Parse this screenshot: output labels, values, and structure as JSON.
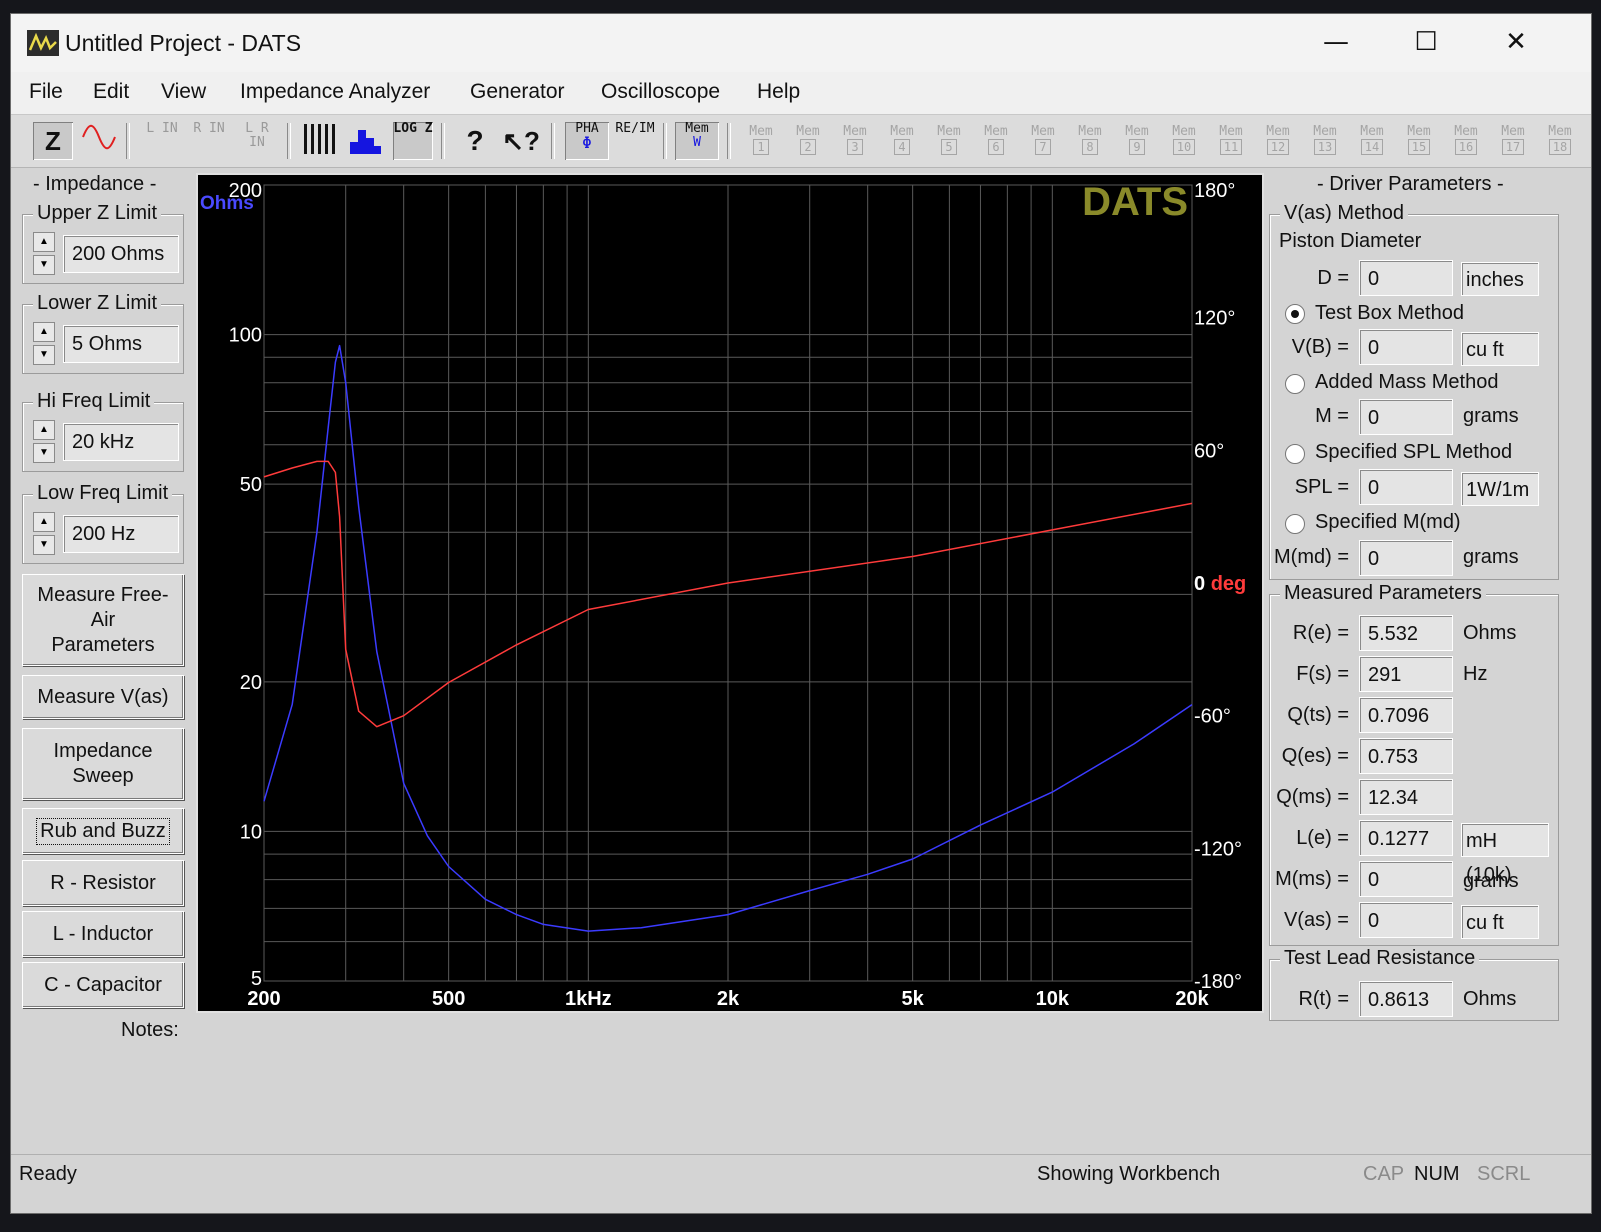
{
  "window": {
    "title": "Untitled Project - DATS",
    "minimize": "—",
    "maximize": "☐",
    "close": "✕"
  },
  "menu": [
    "File",
    "Edit",
    "View",
    "Impedance Analyzer",
    "Generator",
    "Oscilloscope",
    "Help"
  ],
  "toolbar": {
    "z": "Z",
    "l_in": "L IN",
    "r_in": "R IN",
    "lr_in": "L R IN",
    "log_z": "LOG Z",
    "pha": "PHA",
    "pha_sym": "Φ",
    "re_im": "RE/IM",
    "mem_w": "Mem",
    "mem_w_sym": "W",
    "mem_label": "Mem",
    "mem_slots": [
      "1",
      "2",
      "3",
      "4",
      "5",
      "6",
      "7",
      "8",
      "9",
      "10",
      "11",
      "12",
      "13",
      "14",
      "15",
      "16",
      "17",
      "18"
    ]
  },
  "left": {
    "impedance_header": "- Impedance -",
    "upper_z_label": "Upper Z Limit",
    "upper_z_value": "200 Ohms",
    "lower_z_label": "Lower Z Limit",
    "lower_z_value": "5 Ohms",
    "hi_freq_label": "Hi Freq Limit",
    "hi_freq_value": "20 kHz",
    "low_freq_label": "Low Freq Limit",
    "low_freq_value": "200 Hz",
    "btn_free_air": "Measure Free-Air Parameters",
    "btn_vas": "Measure V(as)",
    "btn_sweep": "Impedance Sweep",
    "btn_rub": "Rub and Buzz",
    "btn_resistor": "R - Resistor",
    "btn_inductor": "L - Inductor",
    "btn_capacitor": "C - Capacitor",
    "notes": "Notes:"
  },
  "right": {
    "header": "- Driver Parameters -",
    "vas_method": "V(as) Method",
    "piston_diameter": "Piston Diameter",
    "d_label": "D =",
    "d_value": "0",
    "d_unit": "inches",
    "test_box": "Test Box Method",
    "vb_label": "V(B) =",
    "vb_value": "0",
    "vb_unit": "cu ft",
    "added_mass": "Added Mass Method",
    "m_label": "M =",
    "m_value": "0",
    "m_unit": "grams",
    "spl_method": "Specified SPL Method",
    "spl_label": "SPL =",
    "spl_value": "0",
    "spl_unit": "1W/1m",
    "mmd_method": "Specified M(md)",
    "mmd_label": "M(md) =",
    "mmd_value": "0",
    "mmd_unit": "grams",
    "measured": "Measured Parameters",
    "re_label": "R(e) =",
    "re_value": "5.532",
    "re_unit": "Ohms",
    "fs_label": "F(s) =",
    "fs_value": "291",
    "fs_unit": "Hz",
    "qts_label": "Q(ts) =",
    "qts_value": "0.7096",
    "qes_label": "Q(es) =",
    "qes_value": "0.753",
    "qms_label": "Q(ms) =",
    "qms_value": "12.34",
    "le_label": "L(e) =",
    "le_value": "0.1277",
    "le_unit": "mH (10k)",
    "mms_label": "M(ms) =",
    "mms_value": "0",
    "mms_unit": "grams",
    "vas_label": "V(as) =",
    "vas_value": "0",
    "vas_unit": "cu ft",
    "test_lead": "Test Lead Resistance",
    "rt_label": "R(t) =",
    "rt_value": "0.8613",
    "rt_unit": "Ohms"
  },
  "status": {
    "ready": "Ready",
    "center": "Showing Workbench",
    "cap": "CAP",
    "num": "NUM",
    "scrl": "SCRL"
  },
  "chart_data": {
    "type": "line",
    "watermark": "DATS",
    "xscale": "log",
    "xlim": [
      200,
      20000
    ],
    "ylim_left": [
      5,
      200
    ],
    "yscale_left": "log",
    "ylim_right": [
      -180,
      180
    ],
    "left_unit": "Ohms",
    "right_unit": "deg",
    "x_ticks": [
      {
        "v": 200,
        "label": "200"
      },
      {
        "v": 500,
        "label": "500"
      },
      {
        "v": 1000,
        "label": "1kHz"
      },
      {
        "v": 2000,
        "label": "2k"
      },
      {
        "v": 5000,
        "label": "5k"
      },
      {
        "v": 10000,
        "label": "10k"
      },
      {
        "v": 20000,
        "label": "20k"
      }
    ],
    "y_ticks_left": [
      {
        "v": 200,
        "label": "200"
      },
      {
        "v": 100,
        "label": "100"
      },
      {
        "v": 50,
        "label": "50"
      },
      {
        "v": 20,
        "label": "20"
      },
      {
        "v": 10,
        "label": "10"
      },
      {
        "v": 5,
        "label": "5"
      }
    ],
    "y_ticks_right": [
      {
        "v": 180,
        "label": "180°"
      },
      {
        "v": 120,
        "label": "120°"
      },
      {
        "v": 60,
        "label": "60°"
      },
      {
        "v": 0,
        "label": "0 deg"
      },
      {
        "v": -60,
        "label": "-60°"
      },
      {
        "v": -120,
        "label": "-120°"
      },
      {
        "v": -180,
        "label": "-180°"
      }
    ],
    "grid": true,
    "series": [
      {
        "color": "#3b3bff",
        "axis": "left",
        "x": [
          200,
          230,
          260,
          275,
          285,
          291,
          300,
          320,
          350,
          400,
          450,
          500,
          600,
          700,
          800,
          1000,
          1300,
          2000,
          3000,
          4000,
          5000,
          7000,
          10000,
          15000,
          20000
        ],
        "y": [
          11.5,
          18,
          40,
          65,
          88,
          95,
          80,
          45,
          23,
          12.5,
          9.8,
          8.5,
          7.3,
          6.8,
          6.5,
          6.3,
          6.4,
          6.8,
          7.6,
          8.2,
          8.8,
          10.3,
          12,
          15,
          18
        ]
      },
      {
        "color": "#ff3b3b",
        "axis": "right",
        "x": [
          200,
          230,
          260,
          275,
          285,
          291,
          300,
          320,
          350,
          400,
          500,
          700,
          1000,
          2000,
          5000,
          10000,
          20000
        ],
        "y": [
          48,
          52,
          55,
          55,
          50,
          30,
          -30,
          -58,
          -65,
          -60,
          -45,
          -28,
          -12,
          0,
          12,
          24,
          36
        ]
      }
    ]
  }
}
